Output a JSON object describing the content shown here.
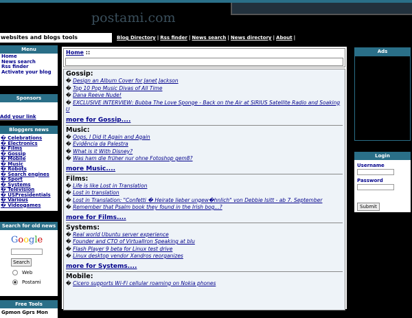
{
  "header": {
    "site_title": "postami.com",
    "tagline": "websites and blogs tools",
    "nav": [
      "Blog Directory",
      "Rss finder",
      "News search",
      "News directory",
      "About"
    ],
    "nav_separator": "|"
  },
  "left": {
    "menu_title": "Menu",
    "menu_items": [
      "Home",
      "News search",
      "Rss finder",
      "Activate your blog"
    ],
    "sponsors_title": "Sponsors",
    "add_link": "Add your link",
    "bloggers_title": "Bloggers news",
    "bloggers_items": [
      "Celebrations",
      "Electronics",
      "Films",
      "Gossip",
      "Mobile",
      "Music",
      "Robots",
      "Search engines",
      "Sport",
      "Systems",
      "Television",
      "USPresidentials",
      "Various",
      "Videogames"
    ],
    "bullet": "�",
    "search_title": "Search for old news",
    "search_logo": "Google",
    "search_button": "Search",
    "radio_web": "Web",
    "radio_postami": "Postami",
    "freetools_title": "Free Tools",
    "freetools_item": "Gpmon Gprs Mon"
  },
  "center": {
    "breadcrumb_home": "Home",
    "breadcrumb_sep": "::",
    "sections": [
      {
        "title": "Gossip:",
        "items": [
          "Design an Album Cover for Janet Jackson",
          "Top 10 Pop Music Divas of All Time",
          "Dana Reeve Nude!",
          "EXCLUSIVE INTERVIEW: Bubba The Love Sponge - Back on the Air at SIRIUS Satellite Radio and Soaking U"
        ],
        "more": "more for Gossip...."
      },
      {
        "title": "Music:",
        "items": [
          "Oops, I Did It Again and Again",
          "Evidência da Palestra",
          "What is it With Disney?",
          "Was ham die früher nur ohne Fotoshop gem8?"
        ],
        "more": "more Music...."
      },
      {
        "title": "Films:",
        "items": [
          "Life is like Lost in Translation",
          "Lost in translation",
          "Lost in Translation: \"Confetti � Heirate lieber ungew�hnlich\" von Debbie Isitt - ab 7. September",
          "Remember that Psalm book they found in the Irish bog...?"
        ],
        "more": "more for Films...."
      },
      {
        "title": "Systems:",
        "items": [
          "Real world Ubuntu server experience",
          "Founder and CTO of VirtualIron Speaking at blu",
          "Flash Player 9 beta for Linux test drive",
          "Linux desktop vendor Xandros reorganizes"
        ],
        "more": "more for Systems...."
      },
      {
        "title": "Mobile:",
        "items": [
          "Cicero supports Wi-Fi cellular roaming on Nokia phones"
        ],
        "more": ""
      }
    ]
  },
  "right": {
    "ads_title": "Ads",
    "login_title": "Login",
    "username_label": "Username",
    "password_label": "Password",
    "submit_label": "Submit"
  }
}
